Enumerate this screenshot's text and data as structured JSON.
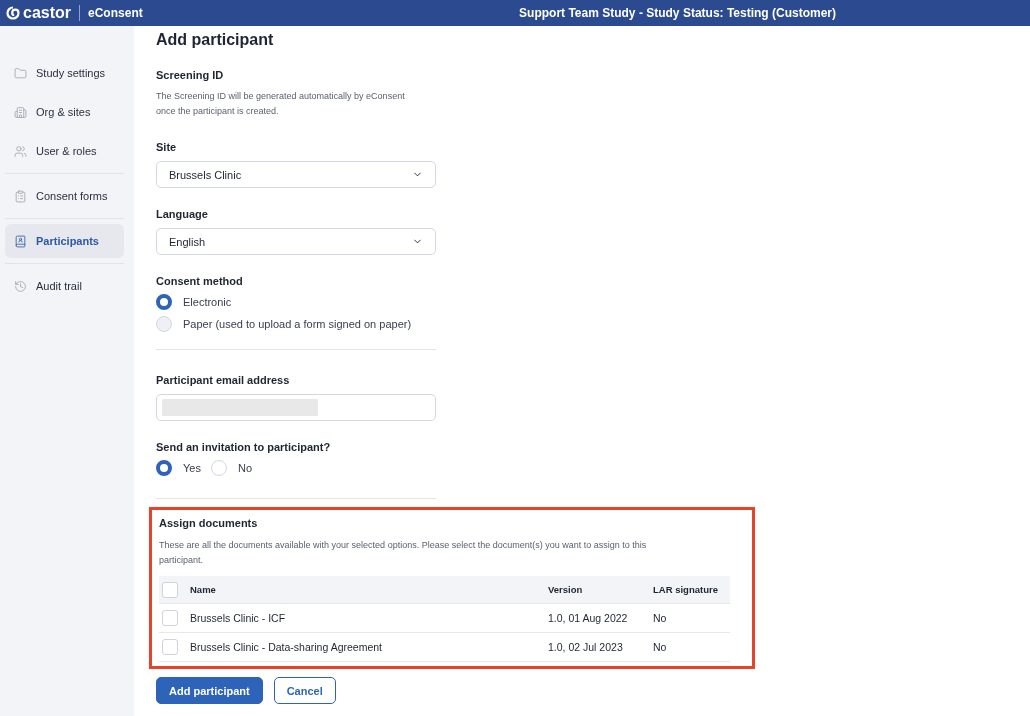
{
  "header": {
    "logo": "castor",
    "product": "eConsent",
    "study": "Support Team Study  - Study Status: Testing (Customer)"
  },
  "sidebar": {
    "groups": [
      [
        {
          "label": "Study settings",
          "kind": "folder",
          "selected": false
        },
        {
          "label": "Org & sites",
          "kind": "building",
          "selected": false
        },
        {
          "label": "User & roles",
          "kind": "users",
          "selected": false
        }
      ],
      [
        {
          "label": "Consent forms",
          "kind": "clipboard",
          "selected": false
        }
      ],
      [
        {
          "label": "Participants",
          "kind": "contacts",
          "selected": true
        }
      ],
      [
        {
          "label": "Audit trail",
          "kind": "history",
          "selected": false
        }
      ]
    ]
  },
  "form": {
    "title": "Add participant",
    "screening": {
      "label": "Screening ID",
      "help": "The Screening ID will be generated automatically by eConsent once the participant is created."
    },
    "site": {
      "label": "Site",
      "value": "Brussels Clinic"
    },
    "language": {
      "label": "Language",
      "value": "English"
    },
    "consent_method": {
      "label": "Consent method",
      "options": [
        {
          "label": "Electronic",
          "selected": true
        },
        {
          "label": "Paper (used to upload a form signed on paper)",
          "selected": false
        }
      ]
    },
    "email": {
      "label": "Participant email address",
      "redacted": true
    },
    "invitation": {
      "label": "Send an invitation to participant?",
      "options": [
        {
          "label": "Yes",
          "selected": true
        },
        {
          "label": "No",
          "selected": false
        }
      ]
    },
    "assign": {
      "highlighted": true,
      "title": "Assign documents",
      "help": "These are all the documents available with your selected options. Please select the document(s) you want to assign to this participant.",
      "columns": [
        "Name",
        "Version",
        "LAR signature"
      ],
      "all_checked": false,
      "rows": [
        {
          "name": "Brussels Clinic - ICF",
          "version": "1.0, 01 Aug 2022",
          "lar": "No",
          "checked": false
        },
        {
          "name": "Brussels Clinic - Data-sharing Agreement",
          "version": "1.0, 02 Jul 2023",
          "lar": "No",
          "checked": false
        }
      ]
    },
    "buttons": [
      {
        "label": "Add participant",
        "kind": "primary"
      },
      {
        "label": "Cancel",
        "kind": "secondary"
      }
    ]
  }
}
